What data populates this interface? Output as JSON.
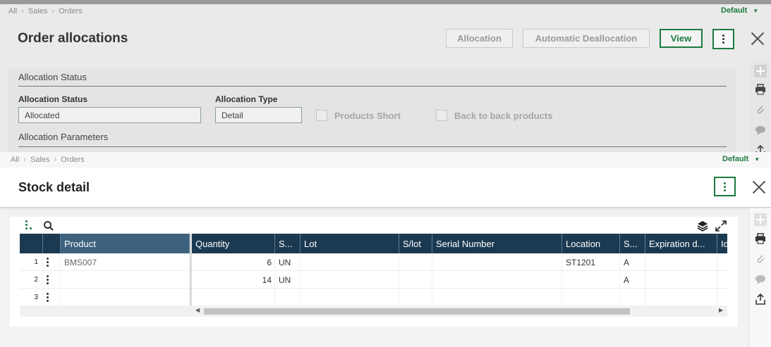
{
  "background_window": {
    "breadcrumb": [
      "All",
      "Sales",
      "Orders"
    ],
    "default_label": "Default",
    "title": "Order allocations",
    "buttons": {
      "allocation": "Allocation",
      "automatic_deallocation": "Automatic Deallocation",
      "view": "View"
    },
    "section_allocation_status": "Allocation Status",
    "fields": {
      "allocation_status_label": "Allocation Status",
      "allocation_status_value": "Allocated",
      "allocation_type_label": "Allocation Type",
      "allocation_type_value": "Detail"
    },
    "checkboxes": {
      "products_short": "Products Short",
      "back_to_back": "Back to back products"
    },
    "section_allocation_parameters": "Allocation Parameters"
  },
  "foreground_window": {
    "breadcrumb": [
      "All",
      "Sales",
      "Orders"
    ],
    "default_label": "Default",
    "title": "Stock detail"
  },
  "grid": {
    "columns": [
      "Product",
      "Quantity",
      "S...",
      "Lot",
      "S/lot",
      "Serial Number",
      "Location",
      "S...",
      "Expiration d...",
      "Id"
    ],
    "rows": [
      {
        "num": "1",
        "product": "BMS007",
        "quantity": "6",
        "unit": "UN",
        "lot": "",
        "slot": "",
        "serial": "",
        "location": "ST1201",
        "status": "A",
        "expiration": ""
      },
      {
        "num": "2",
        "product": "",
        "quantity": "14",
        "unit": "UN",
        "lot": "",
        "slot": "",
        "serial": "",
        "location": "",
        "status": "A",
        "expiration": ""
      },
      {
        "num": "3",
        "product": "",
        "quantity": "",
        "unit": "",
        "lot": "",
        "slot": "",
        "serial": "",
        "location": "",
        "status": "",
        "expiration": ""
      }
    ]
  },
  "colors": {
    "accent_green": "#1c7a3f",
    "grid_header": "#1b3a52",
    "grid_header_frozen": "#3c627f"
  }
}
